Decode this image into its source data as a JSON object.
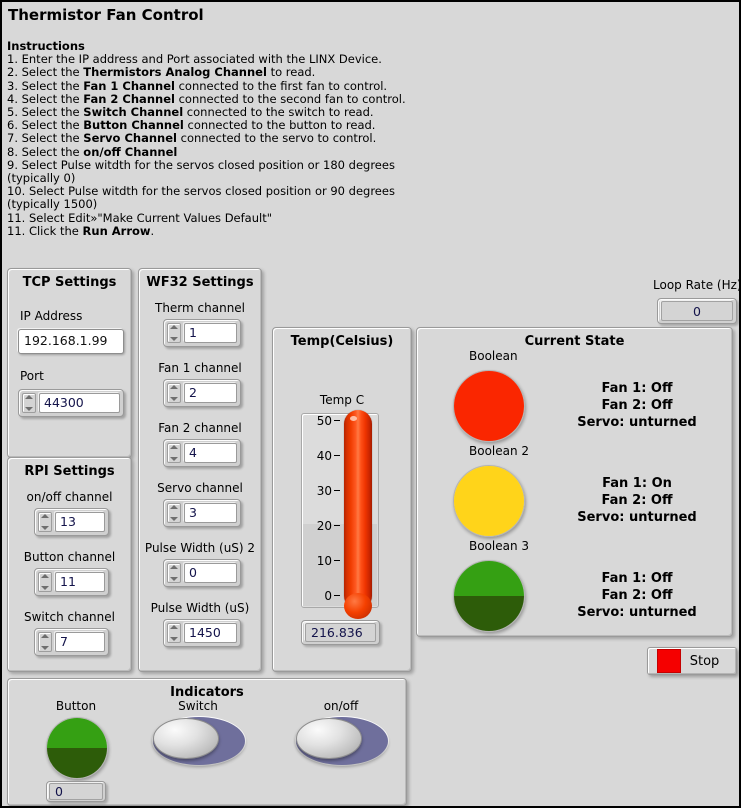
{
  "window": {
    "title": "Thermistor Fan Control"
  },
  "instructions": {
    "heading": "Instructions",
    "lines": [
      "1. Enter the IP address and Port associated with the LINX Device.",
      "2. Select the <b>Thermistors Analog Channel</b> to read.",
      "3. Select the <b>Fan 1 Channel</b> connected to the first fan to control.",
      "4. Select the <b>Fan 2 Channel</b> connected to the second fan to control.",
      "5. Select the <b>Switch Channel</b> connected to the switch to read.",
      "6. Select the <b>Button Channel</b> connected to the button to read.",
      "7. Select the <b>Servo Channel</b> connected to the servo to control.",
      "8. Select the <b>on/off Channel</b>",
      "9. Select Pulse witdth for the servos closed position or 180 degrees (typically 0)",
      "10. Select Pulse witdth for the servos closed position or 90 degrees (typically 1500)",
      "11. Select Edit»\"Make Current Values Default\"",
      "11. Click the <b>Run Arrow</b>."
    ]
  },
  "tcp_settings": {
    "title": "TCP Settings",
    "ip_label": "IP Address",
    "ip_value": "192.168.1.99",
    "port_label": "Port",
    "port_value": "44300"
  },
  "rpi_settings": {
    "title": "RPI Settings",
    "fields": [
      {
        "label": "on/off channel",
        "value": "13"
      },
      {
        "label": "Button channel",
        "value": "11"
      },
      {
        "label": "Switch channel",
        "value": "7"
      }
    ]
  },
  "wf32_settings": {
    "title": "WF32 Settings",
    "fields": [
      {
        "label": "Therm  channel",
        "value": "1"
      },
      {
        "label": "Fan 1 channel",
        "value": "2"
      },
      {
        "label": "Fan 2 channel",
        "value": "4"
      },
      {
        "label": "Servo  channel",
        "value": "3"
      },
      {
        "label": "Pulse Width (uS) 2",
        "value": "0"
      },
      {
        "label": "Pulse Width (uS)",
        "value": "1450"
      }
    ]
  },
  "temperature": {
    "title": "Temp(Celsius)",
    "gauge_label": "Temp C",
    "ticks": [
      "50",
      "40",
      "30",
      "20",
      "10",
      "0"
    ],
    "scale_min": 0,
    "scale_max": 55,
    "value": "216.836",
    "fill_color": "#f03c00"
  },
  "loop_rate": {
    "label": "Loop Rate (Hz)",
    "value": "0"
  },
  "current_state": {
    "title": "Current State",
    "rows": [
      {
        "led_label": "Boolean",
        "led_color_top": "#fa2600",
        "led_color_bottom": "#fa2600",
        "lines": [
          "Fan 1: Off",
          "Fan 2: Off",
          "Servo: unturned"
        ]
      },
      {
        "led_label": "Boolean 2",
        "led_color_top": "#ffd41a",
        "led_color_bottom": "#ffd41a",
        "lines": [
          "Fan 1: On",
          "Fan 2: Off",
          "Servo: unturned"
        ]
      },
      {
        "led_label": "Boolean 3",
        "led_color_top": "#35a013",
        "led_color_bottom": "#2d5c09",
        "lines": [
          "Fan 1: Off",
          "Fan 2: Off",
          "Servo: unturned"
        ]
      }
    ]
  },
  "stop_button": {
    "label": "Stop",
    "color": "#f50000"
  },
  "indicators": {
    "title": "Indicators",
    "button": {
      "label": "Button",
      "led_color_top": "#35a013",
      "led_color_bottom": "#2d5c09",
      "value": "0"
    },
    "switches": [
      {
        "label": "Switch",
        "state": "off",
        "track_color": "#6f6f9c"
      },
      {
        "label": "on/off",
        "state": "off",
        "track_color": "#6f6f9c"
      }
    ]
  }
}
